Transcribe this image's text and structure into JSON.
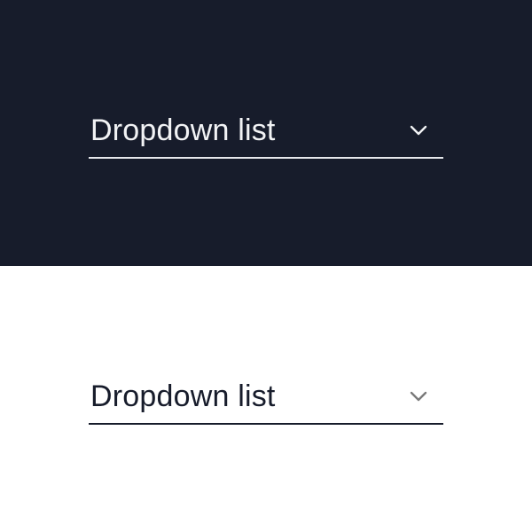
{
  "variants": {
    "dark": {
      "label": "Dropdown list"
    },
    "light": {
      "label": "Dropdown list"
    }
  },
  "colors": {
    "dark_bg": "#171c2b",
    "light_bg": "#ffffff",
    "dark_text": "#f2f3f5",
    "light_text": "#171c2b",
    "light_chevron": "#7a7a7a"
  }
}
